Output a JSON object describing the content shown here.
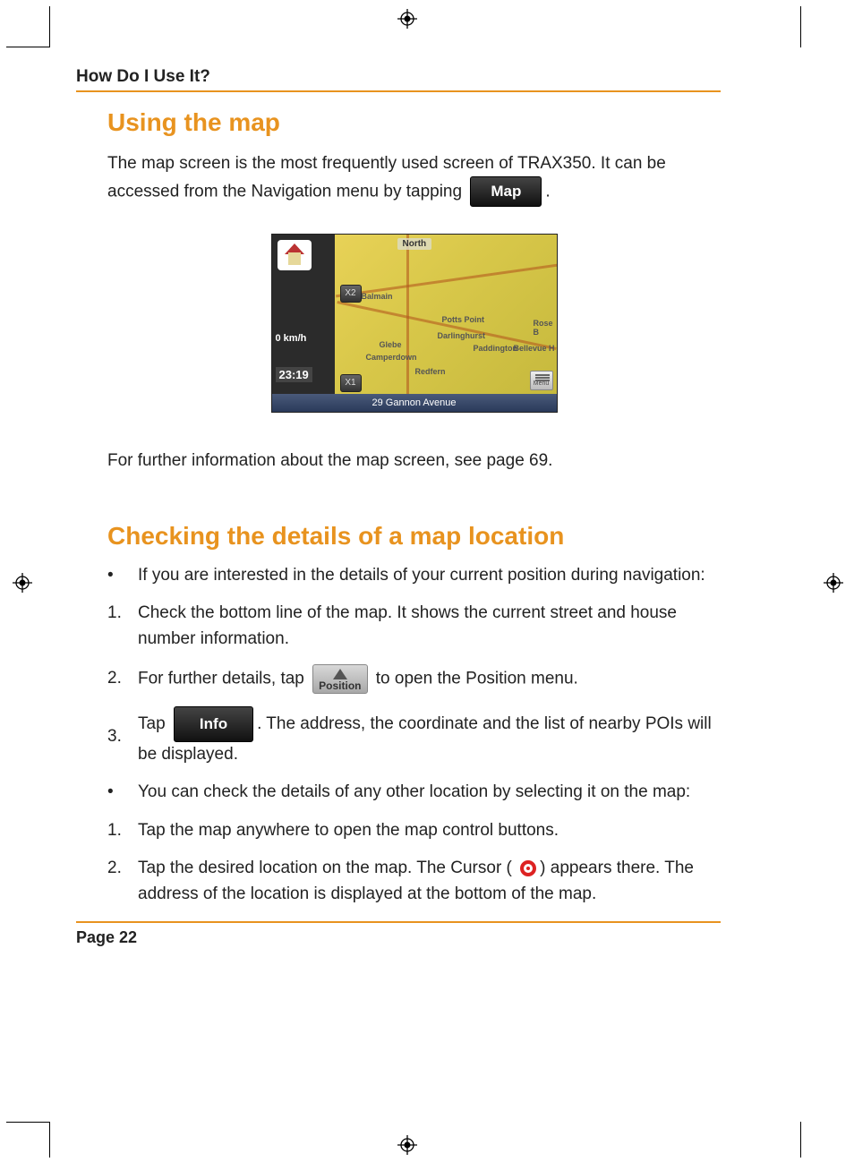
{
  "header": {
    "section_title": "How Do I Use It?"
  },
  "section1": {
    "heading": "Using the map",
    "intro_part1": "The map screen is the most frequently used screen of TRAX350. It can be accessed from the Navigation menu by tapping ",
    "intro_part2": ".",
    "map_btn_label": "Map",
    "further": "For further information about the map screen, see page 69."
  },
  "map_screenshot": {
    "north": "North",
    "speed": "0 km/h",
    "time": "23:19",
    "zoom_in": "X2",
    "zoom_out": "X1",
    "bottom": "29 Gannon Avenue",
    "menu": "Menu",
    "labels": {
      "a": "Balmain",
      "b": "Potts Point",
      "c": "Glebe",
      "d": "Darlinghurst",
      "e": "Paddington",
      "f": "Camperdown",
      "g": "Redfern",
      "h": "Rose B",
      "i": "Bellevue H"
    }
  },
  "section2": {
    "heading": "Checking the details of a map location",
    "items": [
      {
        "marker": "•",
        "text": "If you are interested in the details of your current position during navigation:"
      },
      {
        "marker": "1.",
        "text": "Check the bottom line of the map. It shows the current street and house number information."
      },
      {
        "marker": "2.",
        "text_a": "For further details, tap ",
        "text_b": " to open the Position menu.",
        "position_btn": "Position"
      },
      {
        "marker": "3.",
        "text_a": "Tap ",
        "text_b": ". The address, the coordinate and the list of nearby POIs will be displayed.",
        "info_btn": "Info"
      },
      {
        "marker": "•",
        "text": "You can check the details of any other location by selecting it on the map:"
      },
      {
        "marker": "1.",
        "text": "Tap the map anywhere to open the map control buttons."
      },
      {
        "marker": "2.",
        "text_a": "Tap the desired location on the map. The Cursor (",
        "text_b": ") appears there. The address of the location is displayed at the bottom of the map."
      }
    ]
  },
  "footer": {
    "page": "Page 22"
  }
}
